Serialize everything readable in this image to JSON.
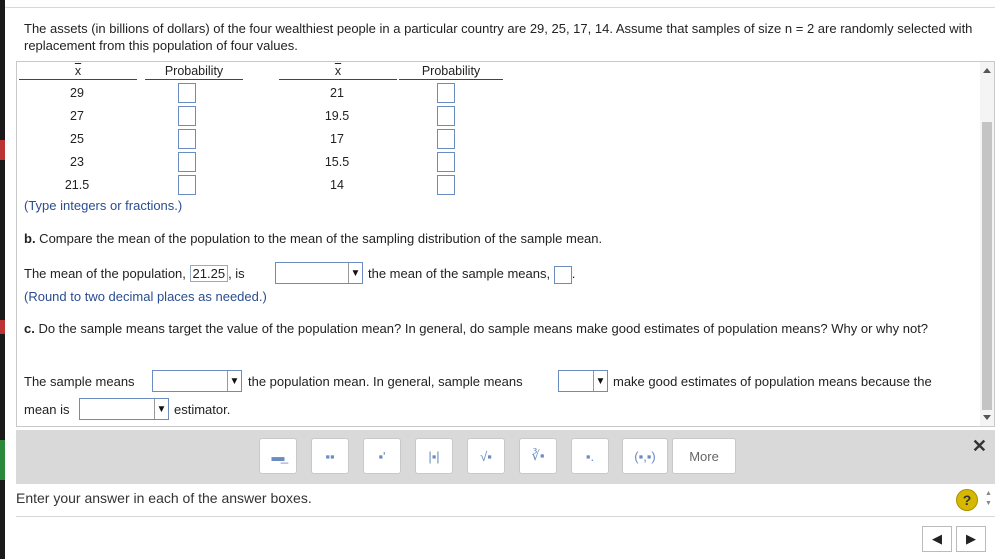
{
  "question": "The assets (in billions of dollars) of the four wealthiest people in a particular country are 29, 25, 17, 14. Assume that samples of size n = 2 are randomly selected with replacement from this population of four values.",
  "table": {
    "xbar_header": "x",
    "prob_header": "Probability",
    "left_x": [
      "29",
      "27",
      "25",
      "23",
      "21.5"
    ],
    "right_x": [
      "21",
      "19.5",
      "17",
      "15.5",
      "14"
    ]
  },
  "type_note": "(Type integers or fractions.)",
  "part_b": {
    "label": "b.",
    "question": " Compare the mean of the population to the mean of the sampling distribution of the sample mean.",
    "sentence_prefix": "The mean of the population,",
    "pop_mean_value": "21.25",
    "is_text": ", is",
    "sentence_suffix": "the mean of the sample means,",
    "end_period": ".",
    "round_note": "(Round to two decimal places as needed.)"
  },
  "part_c": {
    "label": "c.",
    "question": " Do the sample means target the value of the population mean? In general, do sample means make good estimates of population means? Why or why not?",
    "s1": "The sample means",
    "s2": "the population mean. In general, sample means",
    "s3": "make good estimates of population means because the",
    "s4": "mean is",
    "s5": "estimator."
  },
  "toolbar": {
    "b1": "▬̲",
    "b2": "▪▪",
    "b3": "▪'",
    "b4": "|▪|",
    "b5": "√▪",
    "b6": "∛▪",
    "b7": "▪.",
    "b8": "(▪,▪)",
    "more": "More",
    "close": "✕"
  },
  "footer": "Enter your answer in each of the answer boxes.",
  "help": "?",
  "nav": {
    "prev": "◀",
    "next": "▶"
  }
}
